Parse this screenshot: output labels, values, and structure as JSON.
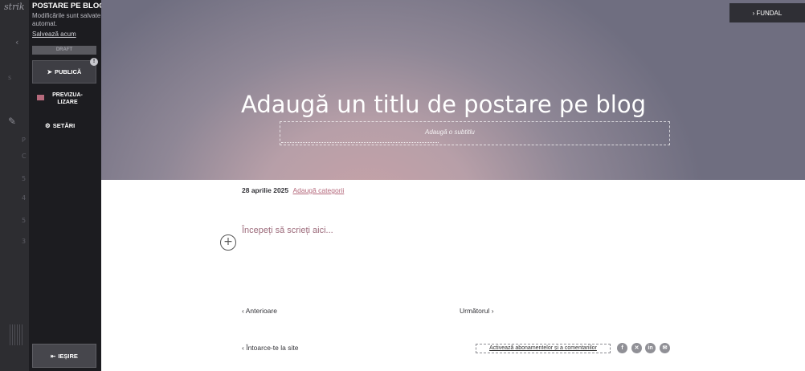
{
  "rail": {
    "brand": "strik",
    "back_icon": "chevron-left-icon",
    "pen_icon": "pen-icon"
  },
  "sidebar": {
    "title": "POSTARE PE BLOG",
    "autosave_note": "Modificările sunt salvate automat.",
    "save_now": "Salvează acum",
    "status": "DRAFT",
    "publish_label": "PUBLICĂ",
    "publish_badge": "!",
    "preview_label": "PREVIZUA-LIZARE",
    "settings_label": "SETĂRI",
    "exit_label": "IEȘIRE"
  },
  "hero": {
    "background_button": "FUNDAL",
    "post_title": "Adaugă un titlu de postare pe blog",
    "subtitle_placeholder": "Adaugă o subtitlu"
  },
  "post": {
    "date": "28 aprilie 2025",
    "add_categories": "Adaugă categorii",
    "body_placeholder": "Începeți să scrieți aici...",
    "add_block": "+"
  },
  "footer": {
    "previous": "Anterioare",
    "next": "Următorul",
    "back_to_site": "Întoarce-te la site",
    "enable_subscriptions": "Activează abonamentelor și a comentariilor",
    "social": [
      "f",
      "✕",
      "in",
      "✉"
    ]
  },
  "colors": {
    "sidebar_bg": "#1c1c20",
    "accent": "#b4677a",
    "hero_center": "#c7a2a7",
    "hero_edge": "#6f6e80"
  }
}
